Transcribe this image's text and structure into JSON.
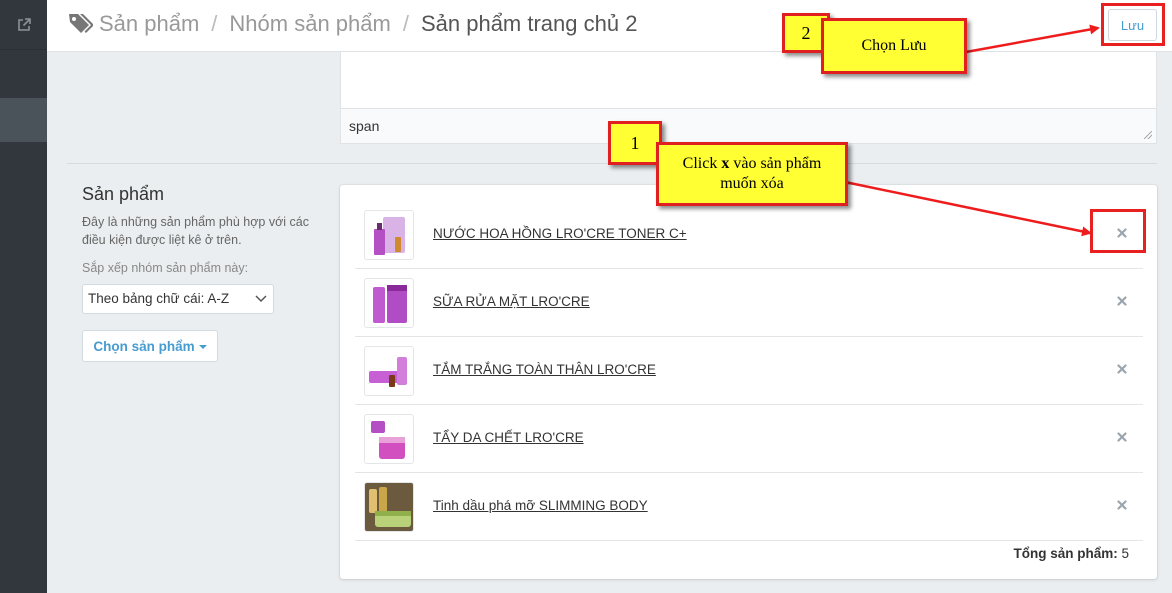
{
  "breadcrumb": {
    "items": [
      "Sản phẩm",
      "Nhóm sản phẩm"
    ],
    "current": "Sản phẩm trang chủ 2"
  },
  "toolbar": {
    "save_label": "Lưu"
  },
  "editor": {
    "status_text": "span"
  },
  "products_section": {
    "title": "Sản phẩm",
    "description": "Đây là những sản phẩm phù hợp với các điều kiện được liệt kê ở trên.",
    "sort_label": "Sắp xếp nhóm sản phẩm này:",
    "sort_value": "Theo bảng chữ cái: A-Z",
    "pick_button": "Chọn sản phẩm"
  },
  "products": [
    {
      "name": "NƯỚC HOA HỒNG LRO'CRE TONER C+"
    },
    {
      "name": "SỮA RỬA MẶT LRO'CRE"
    },
    {
      "name": "TẮM TRẮNG TOÀN THÂN LRO'CRE"
    },
    {
      "name": "TẨY DA CHẾT LRO'CRE"
    },
    {
      "name": "Tinh dầu phá mỡ SLIMMING BODY"
    }
  ],
  "total": {
    "label": "Tổng sản phẩm:",
    "count": "5"
  },
  "annotations": {
    "step1_number": "1",
    "step1_text_a": "Click ",
    "step1_text_x": "x",
    "step1_text_b": " vào sản phẩm muốn xóa",
    "step2_number": "2",
    "step2_text": "Chọn Lưu"
  },
  "colors": {
    "accent": "#479ccf",
    "sidebar": "#31373d",
    "annotation_fill": "#ffff33",
    "annotation_border": "#e02020"
  }
}
